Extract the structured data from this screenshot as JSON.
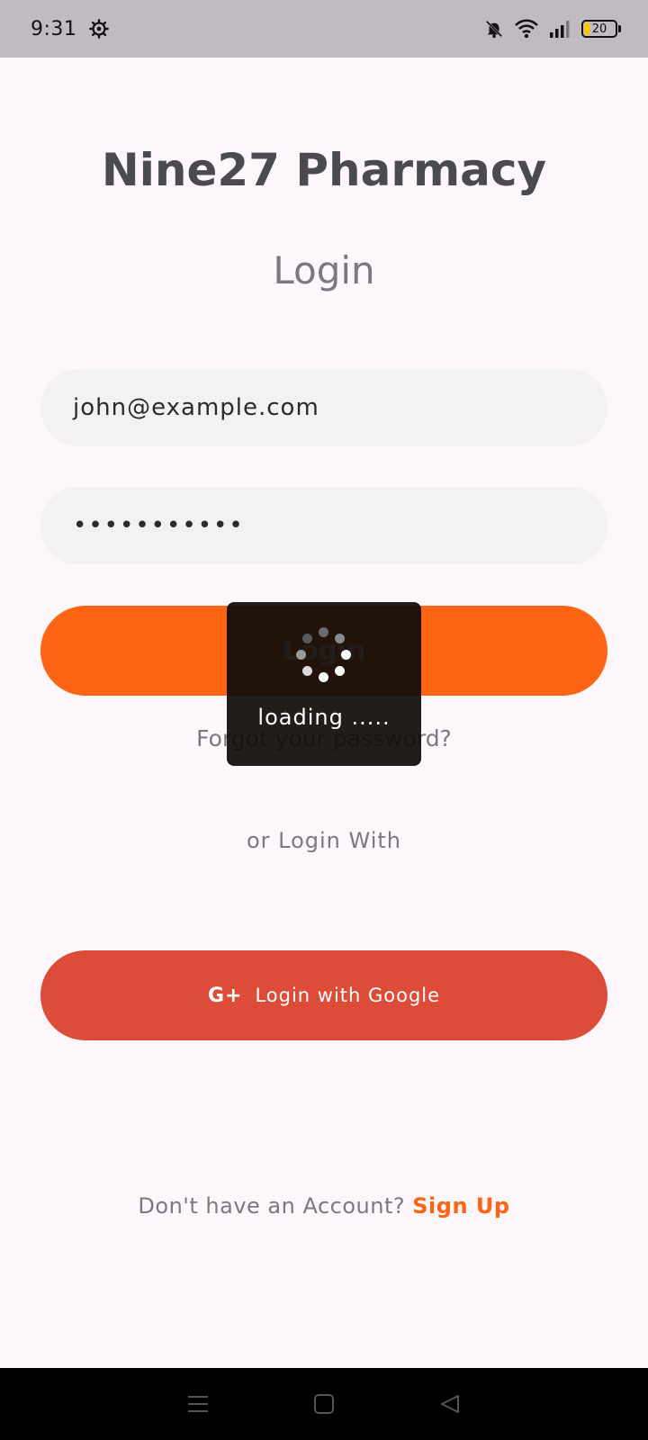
{
  "status_bar": {
    "time": "9:31",
    "battery_level": "20",
    "icons": [
      "settings-gear-icon",
      "bell-muted-icon",
      "wifi-icon",
      "signal-icon",
      "battery-icon"
    ]
  },
  "app": {
    "title": "Nine27 Pharmacy",
    "screen_title": "Login"
  },
  "form": {
    "email_value": "john@example.com",
    "password_value": "•••••••••••",
    "login_label": "Login",
    "forgot_label": "Forgot your password?",
    "or_label": "or Login With",
    "google_label": "Login with Google",
    "google_icon_glyph": "G+"
  },
  "footer": {
    "prompt": "Don't have an Account?",
    "signup_label": "Sign Up"
  },
  "loading": {
    "text": "loading ....."
  },
  "nav_bar": {
    "buttons": [
      "menu-icon",
      "home-square-icon",
      "back-triangle-icon"
    ]
  },
  "colors": {
    "accent": "#fd6413",
    "google": "#dd4b39",
    "background": "#fdf6fb",
    "field": "#f2f2f2"
  }
}
